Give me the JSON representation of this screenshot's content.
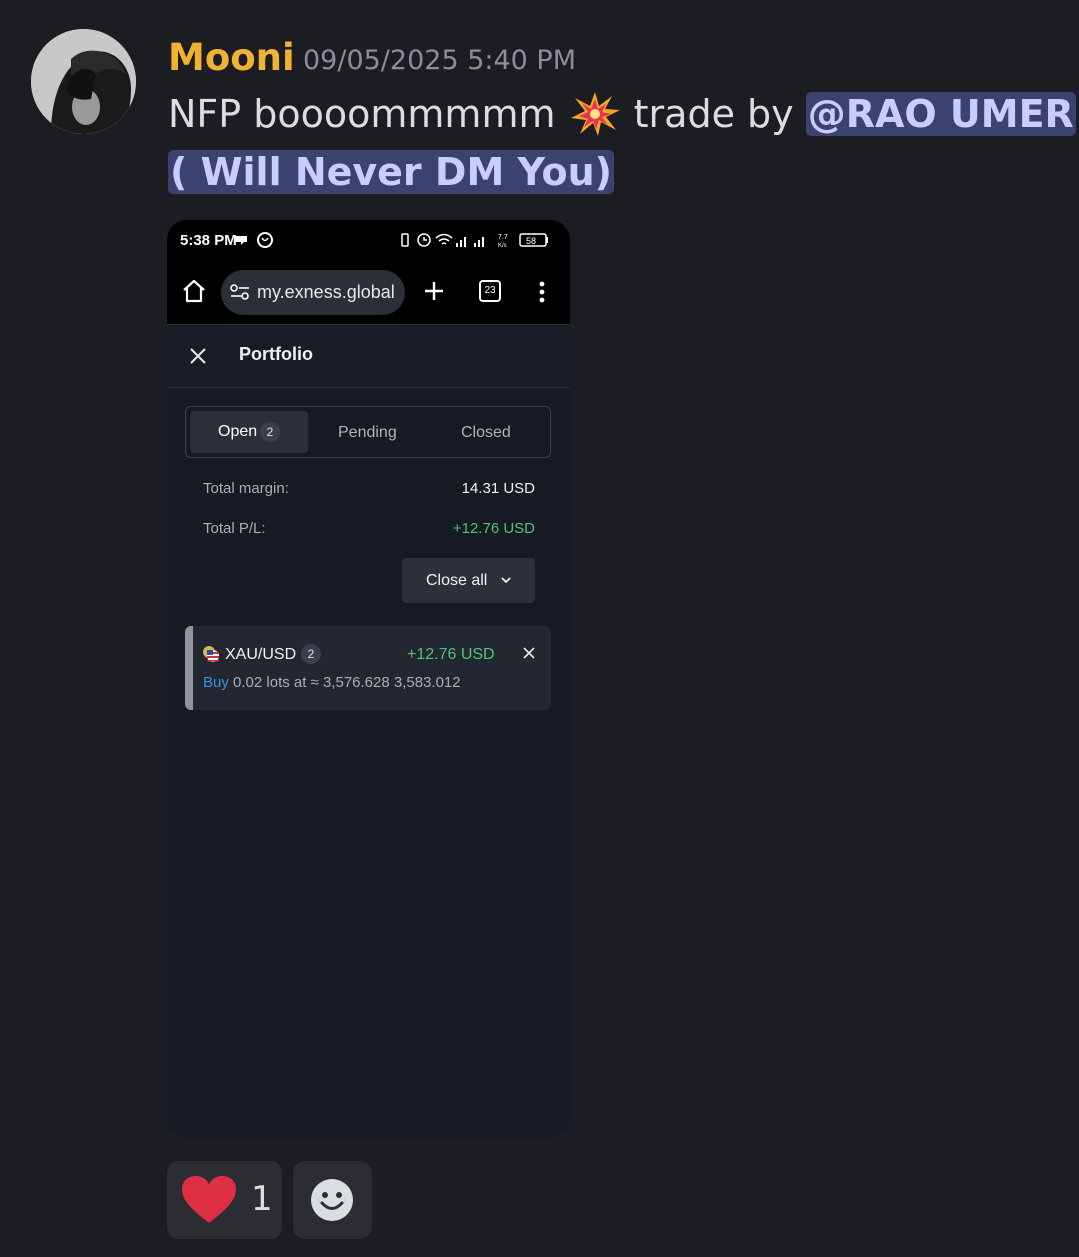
{
  "message": {
    "username": "Mooni",
    "timestamp": "09/05/2025 5:40 PM",
    "text_before_emoji": "NFP boooommmmm ",
    "emoji_icon": "collision-emoji-icon",
    "text_after_emoji": " trade by ",
    "mention_line1": "@RAO UMER",
    "mention_line2": "( Will Never DM You)"
  },
  "phone": {
    "status_time": "5:38 PM",
    "speed_top": "7.7",
    "speed_bottom": "K/s",
    "battery": "58",
    "url": "my.exness.global",
    "tab_count": "23",
    "portfolio_title": "Portfolio",
    "tabs": [
      {
        "label": "Open",
        "badge": "2",
        "selected": true
      },
      {
        "label": "Pending"
      },
      {
        "label": "Closed"
      }
    ],
    "total_margin_label": "Total margin:",
    "total_margin_value": "14.31 USD",
    "total_pl_label": "Total P/L:",
    "total_pl_value": "+12.76 USD",
    "close_all_label": "Close all",
    "position": {
      "symbol": "XAU/USD",
      "count": "2",
      "pl": "+12.76 USD",
      "side": "Buy",
      "detail": " 0.02 lots at ≈ 3,576.628   3,583.012"
    }
  },
  "reactions": [
    {
      "icon": "heart-icon",
      "count": "1"
    }
  ],
  "colors": {
    "background": "#1c1d22",
    "username": "#f0b232",
    "mention_bg": "#3c4270",
    "profit": "#4fc37a",
    "buy": "#3d8fe0"
  }
}
